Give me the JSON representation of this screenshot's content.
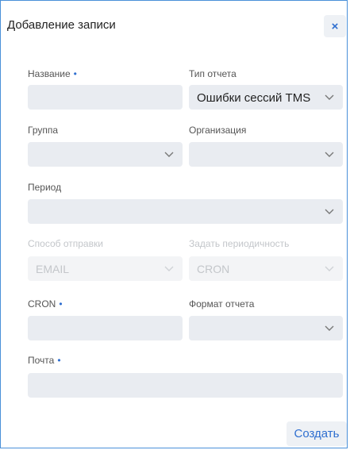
{
  "dialog": {
    "title": "Добавление записи",
    "close_symbol": "×",
    "create_label": "Создать"
  },
  "fields": {
    "name": {
      "label": "Название",
      "required_mark": "•",
      "value": ""
    },
    "report_type": {
      "label": "Тип отчета",
      "value": "Ошибки сессий TMS"
    },
    "group": {
      "label": "Группа",
      "value": ""
    },
    "organization": {
      "label": "Организация",
      "value": ""
    },
    "period": {
      "label": "Период",
      "value": ""
    },
    "send_method": {
      "label": "Способ отправки",
      "value": "EMAIL",
      "disabled": true
    },
    "periodicity": {
      "label": "Задать периодичность",
      "value": "CRON",
      "disabled": true
    },
    "cron": {
      "label": "CRON",
      "required_mark": "•",
      "value": ""
    },
    "report_format": {
      "label": "Формат отчета",
      "value": ""
    },
    "email": {
      "label": "Почта",
      "required_mark": "•",
      "value": ""
    }
  },
  "colors": {
    "accent": "#2f6fd0",
    "border": "#4a90d9",
    "field_bg": "#e9ecf1",
    "disabled_text": "#c3c6ca"
  },
  "icons": {
    "close": "close-icon",
    "dropdown": "chevron-down-icon"
  }
}
